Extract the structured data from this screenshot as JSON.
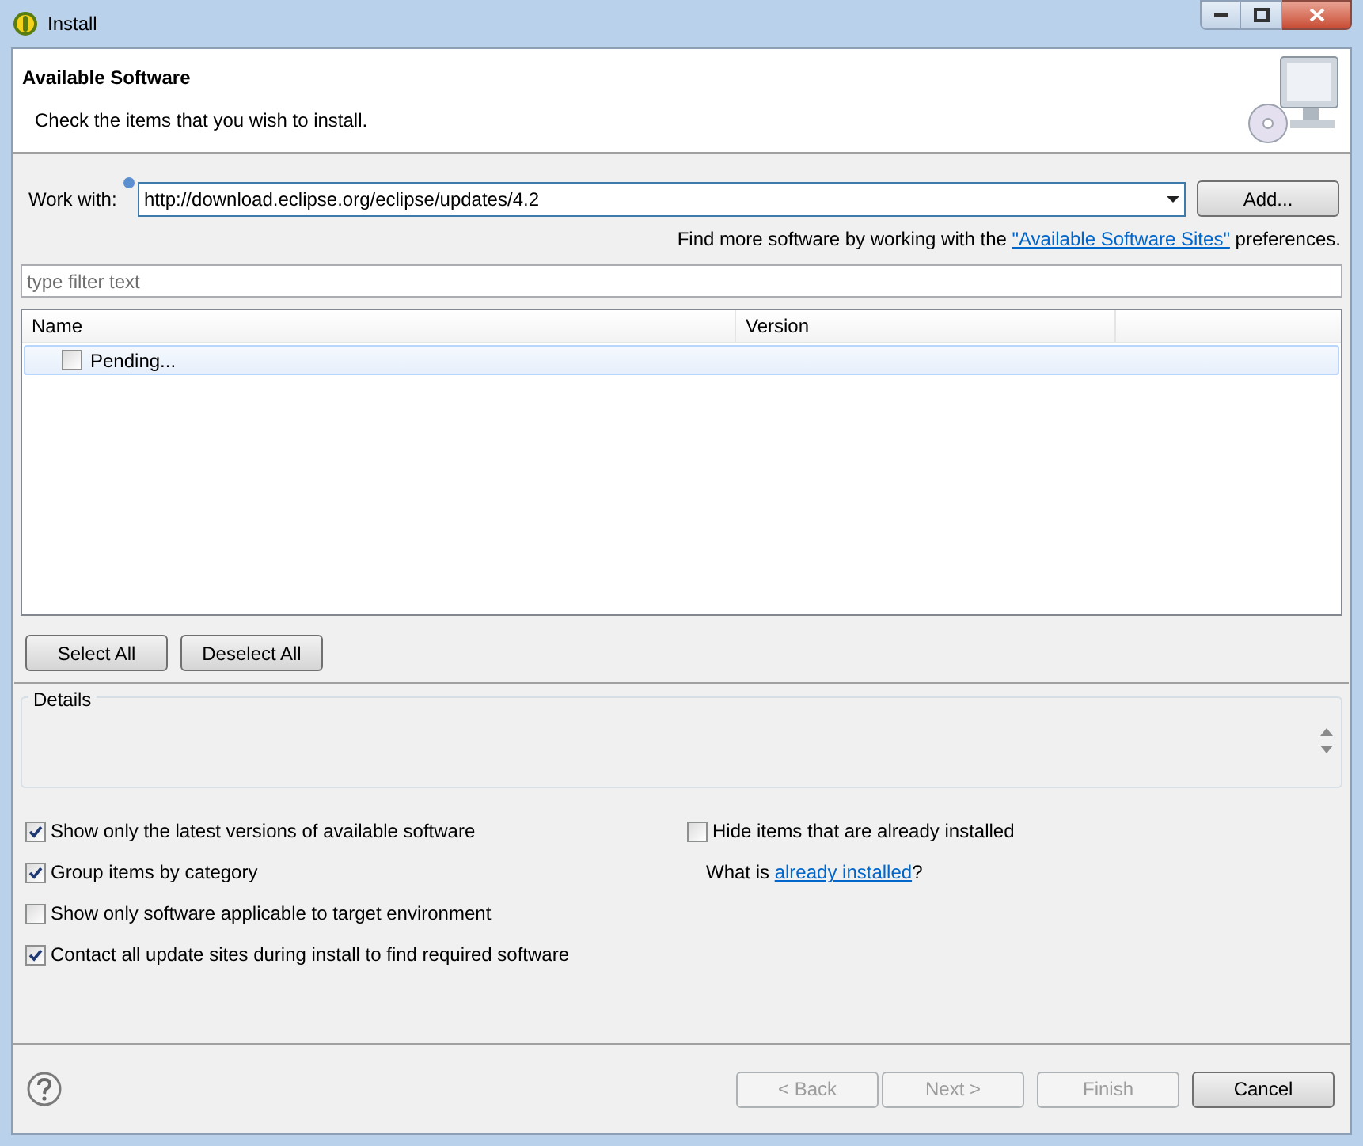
{
  "window": {
    "title": "Install"
  },
  "header": {
    "title": "Available Software",
    "subtitle": "Check the items that you wish to install."
  },
  "work_with": {
    "label": "Work with:",
    "value": "http://download.eclipse.org/eclipse/updates/4.2"
  },
  "add_button": "Add...",
  "find_more": {
    "before": "Find more software by working with the ",
    "link": "\"Available Software Sites\"",
    "after": " preferences."
  },
  "filter": {
    "placeholder": "type filter text"
  },
  "table": {
    "columns": [
      "Name",
      "Version"
    ],
    "rows": [
      {
        "label": "Pending...",
        "checked": false,
        "selected": true
      }
    ]
  },
  "selection_buttons": [
    "Select All",
    "Deselect All"
  ],
  "details": {
    "label": "Details"
  },
  "options_left": [
    {
      "label": "Show only the latest versions of available software",
      "checked": true
    },
    {
      "label": "Group items by category",
      "checked": true
    },
    {
      "label": "Show only software applicable to target environment",
      "checked": false
    },
    {
      "label": "Contact all update sites during install to find required software",
      "checked": true
    }
  ],
  "options_right": [
    {
      "label": "Hide items that are already installed",
      "checked": false
    }
  ],
  "what_is": {
    "before": "What is ",
    "link": "already installed",
    "after": "?"
  },
  "footer_buttons": [
    {
      "label": "< Back",
      "disabled": true
    },
    {
      "label": "Next >",
      "disabled": true
    },
    {
      "label": "Finish",
      "disabled": true
    },
    {
      "label": "Cancel",
      "disabled": false
    }
  ]
}
